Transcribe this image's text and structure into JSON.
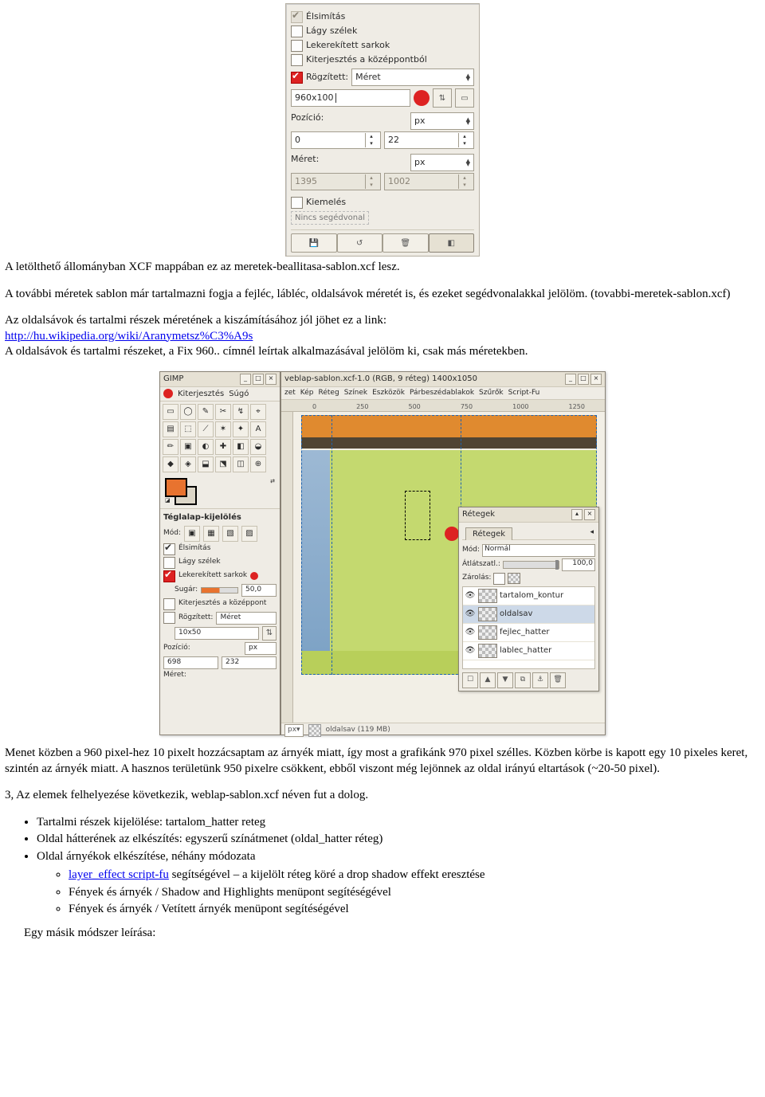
{
  "panel1": {
    "options": {
      "antialias": "Élsimítás",
      "antialias_checked": true,
      "soft_edges": "Lágy szélek",
      "rounded_corners": "Lekerekített sarkok",
      "expand_center": "Kiterjesztés a középpontból",
      "fixed_label": "Rögzített:",
      "fixed_select": "Méret",
      "fixed_value": "960x100",
      "position_label": "Pozíció:",
      "position_unit": "px",
      "position_x": "0",
      "position_y": "22",
      "size_label": "Méret:",
      "size_unit": "px",
      "size_w": "1395",
      "size_h": "1002",
      "highlight": "Kiemelés",
      "truncated": "Nincs segédvonal"
    }
  },
  "text": {
    "p1": "A letölthető állományban XCF mappában ez az meretek-beallitasa-sablon.xcf lesz.",
    "p2a": "A további méretek sablon már tartalmazni fogja a fejléc, lábléc, oldalsávok méretét is, és ezeket segédvonalakkal jelölöm. (tovabbi-meretek-sablon.xcf)",
    "p3a": "Az oldalsávok és tartalmi részek méretének a kiszámításához jól jöhet ez a link:",
    "link1": "http://hu.wikipedia.org/wiki/Aranymetsz%C3%A9s",
    "p3b": "A oldalsávok és tartalmi részeket, a Fix 960.. címnél leírtak alkalmazásával jelölöm ki, csak más méretekben.",
    "p4": "Menet közben a 960 pixel-hez 10 pixelt hozzácsaptam az árnyék miatt, így most a grafikánk 970 pixel szélles. Közben körbe is kapott egy 10 pixeles keret, szintén az árnyék miatt. A hasznos területünk 950 pixelre csökkent, ebből viszont még lejönnek az oldal irányú eltartások (~20-50 pixel).",
    "p5": "3, Az elemek felhelyezése következik, weblap-sablon.xcf néven fut a dolog.",
    "bullets": {
      "b1": "Tartalmi részek kijelölése: tartalom_hatter reteg",
      "b2": "Oldal hátterének az elkészítés: egyszerű színátmenet (oldal_hatter réteg)",
      "b3": "Oldal árnyékok elkészítése, néhány módozata",
      "s1a": "layer_effect script-fu",
      "s1b": " segítségével – a kijelölt réteg köré a drop shadow effekt eresztése",
      "s2": "Fények és árnyék / Shadow and Highlights menüpont segítéségével",
      "s3": "Fények és árnyék / Vetített árnyék menüpont segítéségével"
    },
    "cut": "Egy másik módszer leírása:"
  },
  "gimp": {
    "toolbox": {
      "title": "GIMP",
      "menu": [
        "Kiterjesztés",
        "Súgó"
      ],
      "tools": [
        "▭",
        "◯",
        "✎",
        "✂",
        "↯",
        "⌖",
        "▤",
        "⬚",
        "⟋",
        "✶",
        "✦",
        "A",
        "✏",
        "▣",
        "◐",
        "✚",
        "◧",
        "◒",
        "◆",
        "◈",
        "⬓",
        "⬔",
        "◫",
        "⊕"
      ],
      "section_title": "Téglalap-kijelölés",
      "mode_label": "Mód:",
      "antialias": "Élsimítás",
      "soft": "Lágy szélek",
      "rounded": "Lekerekített sarkok",
      "radius_label": "Sugár:",
      "radius_val": "50,0",
      "expand": "Kiterjesztés a középpont",
      "fixed": "Rögzített:",
      "fixed_sel": "Méret",
      "fixed_val": "10x50",
      "pos": "Pozíció:",
      "pos_unit": "px",
      "pos_x": "698",
      "pos_y": "232",
      "size": "Méret:"
    },
    "canvas": {
      "title": "veblap-sablon.xcf-1.0 (RGB, 9 réteg) 1400x1050",
      "menu": [
        "zet",
        "Kép",
        "Réteg",
        "Színek",
        "Eszközök",
        "Párbeszédablakok",
        "Szűrők",
        "Script-Fu"
      ],
      "ruler_ticks": [
        "0",
        "250",
        "500",
        "750",
        "1000",
        "1250"
      ],
      "status_left": "px",
      "status_text": "oldalsav (119 MB)"
    },
    "layers": {
      "title": "Rétegek",
      "tab": "Rétegek",
      "mode_label": "Mód:",
      "mode_val": "Normál",
      "opacity_label": "Átlátszatl.:",
      "opacity_val": "100,0",
      "lock_label": "Zárolás:",
      "items": [
        "tartalom_kontur",
        "oldalsav",
        "fejlec_hatter",
        "lablec_hatter"
      ],
      "selected": 1
    }
  }
}
